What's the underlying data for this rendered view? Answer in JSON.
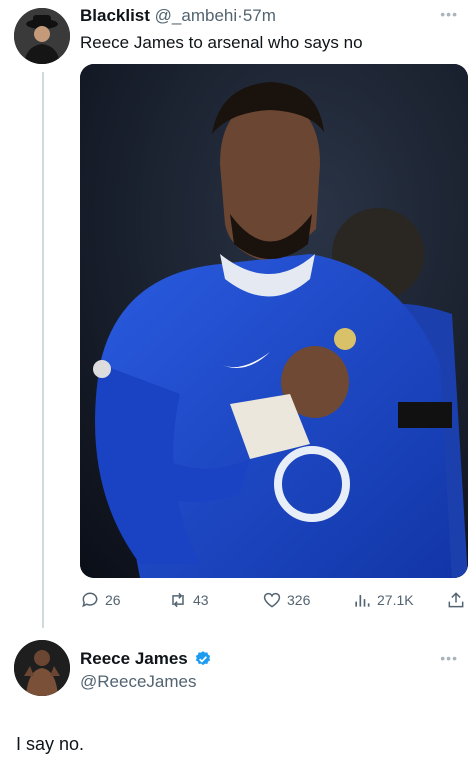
{
  "tweet": {
    "author_name": "Blacklist",
    "author_handle": "@_ambehi",
    "separator": "·",
    "time": "57m",
    "text": "Reece James to arsenal who says no",
    "stats": {
      "replies": "26",
      "retweets": "43",
      "likes": "326",
      "views": "27.1K"
    }
  },
  "reply": {
    "author_name": "Reece James",
    "author_handle": "@ReeceJames",
    "text": "I say no."
  },
  "icons": {
    "more": "more-dots-icon",
    "reply": "speech-bubble-icon",
    "retweet": "retweet-icon",
    "like": "heart-icon",
    "views": "bar-chart-icon",
    "share": "share-icon",
    "verified": "verified-badge-icon"
  },
  "colors": {
    "text": "#0f1419",
    "secondary": "#536471",
    "verified": "#1d9bf0",
    "kit_blue": "#1f46c7"
  }
}
